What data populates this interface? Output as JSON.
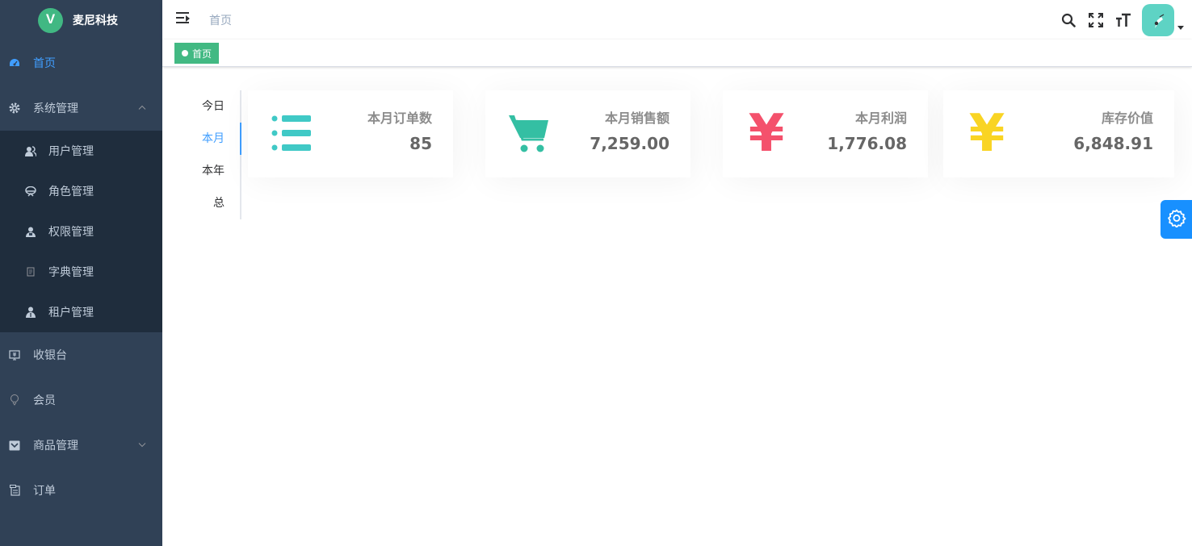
{
  "app": {
    "title": "麦尼科技"
  },
  "sidebar": {
    "items": [
      {
        "label": "首页",
        "icon": "dashboard-icon",
        "active": true
      },
      {
        "label": "系统管理",
        "icon": "gear-icon",
        "expanded": true
      },
      {
        "label": "收银台",
        "icon": "cashier-icon"
      },
      {
        "label": "会员",
        "icon": "member-icon"
      },
      {
        "label": "商品管理",
        "icon": "goods-icon",
        "expanded": false
      },
      {
        "label": "订单",
        "icon": "order-icon"
      }
    ],
    "system_children": [
      {
        "label": "用户管理",
        "icon": "user-icon"
      },
      {
        "label": "角色管理",
        "icon": "role-icon"
      },
      {
        "label": "权限管理",
        "icon": "permission-icon"
      },
      {
        "label": "字典管理",
        "icon": "dictionary-icon"
      },
      {
        "label": "租户管理",
        "icon": "tenant-icon"
      }
    ]
  },
  "header": {
    "breadcrumb": "首页"
  },
  "tags": [
    {
      "label": "首页",
      "active": true
    }
  ],
  "period_tabs": {
    "items": [
      "今日",
      "本月",
      "本年",
      "总"
    ],
    "selected": "本月"
  },
  "stats": [
    {
      "label": "本月订单数",
      "value": "85",
      "icon": "list-icon",
      "color": "#40c9c6"
    },
    {
      "label": "本月销售额",
      "value": "7,259.00",
      "icon": "shopping-cart-icon",
      "color": "#34bfa3"
    },
    {
      "label": "本月利润",
      "value": "1,776.08",
      "icon": "yen-icon",
      "glyph": "¥",
      "color": "#f4516c"
    },
    {
      "label": "库存价值",
      "value": "6,848.91",
      "icon": "yen-icon",
      "glyph": "¥",
      "color": "#f9d423"
    }
  ],
  "colors": {
    "sidebar_bg": "#304156",
    "submenu_bg": "#1f2d3d",
    "accent": "#409eff",
    "tag_green": "#42b983",
    "settings_btn": "#1890ff"
  }
}
